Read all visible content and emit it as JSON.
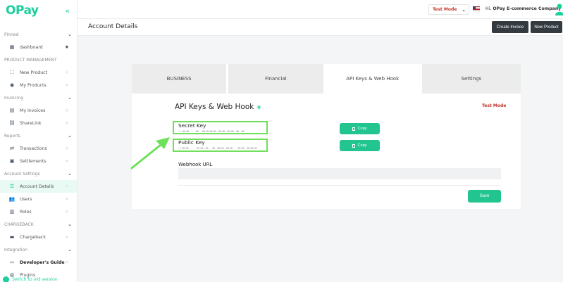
{
  "brand": {
    "logo": "OPay",
    "accent": "#1dcf9f"
  },
  "sidebar": {
    "sections": [
      {
        "label": "Pinned",
        "items": [
          {
            "label": "dashboard",
            "icon": "dashboard-icon",
            "pinned": true
          }
        ]
      },
      {
        "label": "PRODUCT MANAGEMENT",
        "items": [
          {
            "label": "New Product",
            "icon": "new-product-icon"
          },
          {
            "label": "My Products",
            "icon": "products-icon"
          }
        ]
      },
      {
        "label": "Invoicing",
        "items": [
          {
            "label": "My Invoices",
            "icon": "invoice-icon"
          },
          {
            "label": "ShareLink",
            "icon": "link-icon"
          }
        ]
      },
      {
        "label": "Reports",
        "items": [
          {
            "label": "Transactions",
            "icon": "transactions-icon"
          },
          {
            "label": "Settlements",
            "icon": "settlements-icon"
          }
        ]
      },
      {
        "label": "Account Settings",
        "items": [
          {
            "label": "Account Details",
            "icon": "account-details-icon",
            "active": true
          },
          {
            "label": "Users",
            "icon": "users-icon"
          },
          {
            "label": "Roles",
            "icon": "roles-icon"
          }
        ]
      },
      {
        "label": "CHARGEBACK",
        "items": [
          {
            "label": "Chargeback",
            "icon": "chargeback-icon"
          }
        ]
      },
      {
        "label": "Integration",
        "items": [
          {
            "label": "Developer's Guide",
            "icon": "code-icon"
          },
          {
            "label": "Plugins",
            "icon": "plugins-icon"
          }
        ]
      }
    ],
    "switch_label": "Switch to old version"
  },
  "topbar": {
    "mode_select": "Test Mode",
    "greeting_prefix": "Hi,",
    "company": "OPay E-commerce Company"
  },
  "page": {
    "title": "Account Details",
    "create_invoice": "Create Invoice",
    "new_product": "New Product"
  },
  "tabs": [
    {
      "label": "BUSINESS",
      "active": false
    },
    {
      "label": "Financial",
      "active": false
    },
    {
      "label": "API Keys & Web Hook",
      "active": true
    },
    {
      "label": "Settings",
      "active": false
    }
  ],
  "api": {
    "title": "API Keys & Web Hook",
    "mode_label": "Test Mode",
    "secret_key_label": "Secret Key",
    "secret_key_value": "•·▬▬··· ▬ ·▬▬▬▬·▬▬·▬▬ ▬ ▬",
    "public_key_label": "Public Key",
    "public_key_value": "○▬▬ ····▬▬·▬· ▬·▬▬·▬▬ ··▬▬ ▬▬▬",
    "copy_label": "Copy",
    "webhook_label": "Webhook URL",
    "webhook_value": "",
    "save_label": "Save"
  },
  "colors": {
    "highlight": "#6ee05a",
    "button": "#22c48f",
    "test_mode": "#c0392b"
  }
}
